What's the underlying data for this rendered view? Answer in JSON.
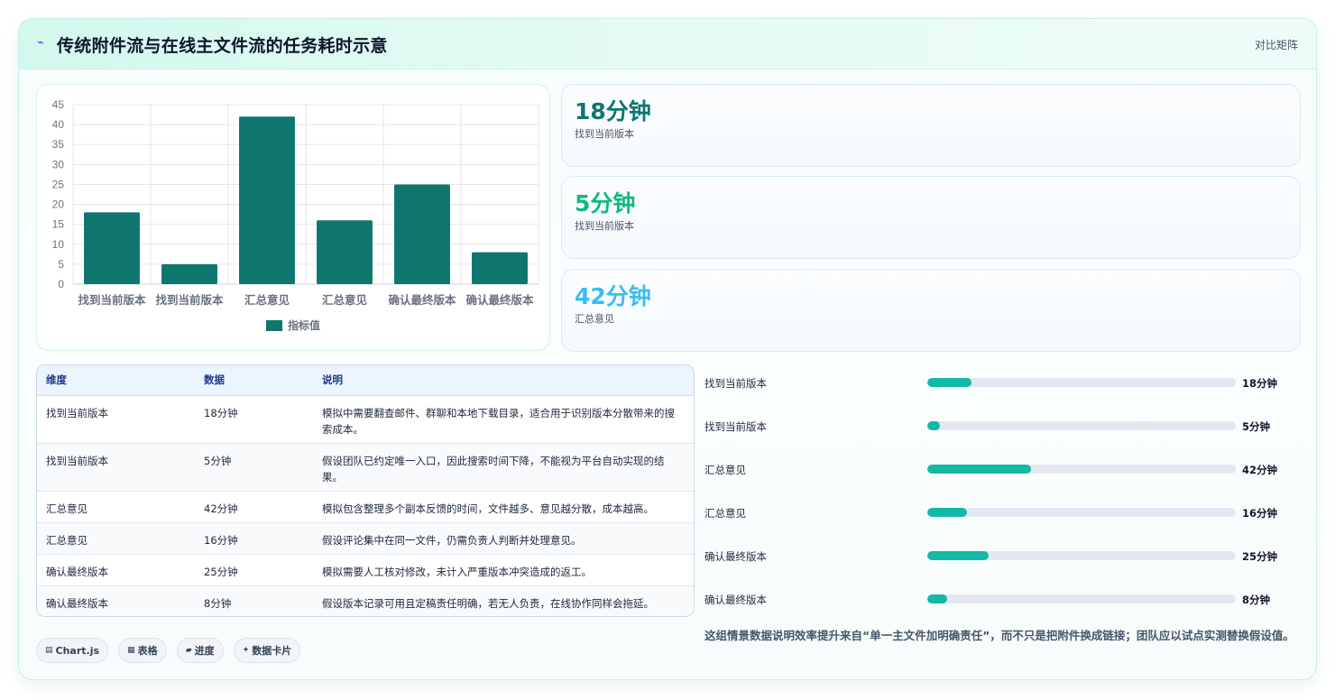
{
  "header": {
    "icon": "lightning-icon",
    "title": "传统附件流与在线主文件流的任务耗时示意",
    "right_label": "对比矩阵"
  },
  "chart_data": {
    "type": "bar",
    "categories": [
      "找到当前版本",
      "找到当前版本",
      "汇总意见",
      "汇总意见",
      "确认最终版本",
      "确认最终版本"
    ],
    "series": [
      {
        "name": "指标值",
        "values": [
          18,
          5,
          42,
          16,
          25,
          8
        ],
        "color": "#0f766e"
      }
    ],
    "title": "",
    "xlabel": "",
    "ylabel": "",
    "ylim": [
      0,
      45
    ],
    "yticks": [
      0,
      5,
      10,
      15,
      20,
      25,
      30,
      35,
      40,
      45
    ],
    "grid": true,
    "legend": "bottom"
  },
  "stats": [
    {
      "value": "18分钟",
      "label": "找到当前版本",
      "color": "#0f766e"
    },
    {
      "value": "5分钟",
      "label": "找到当前版本",
      "color": "#10b981"
    },
    {
      "value": "42分钟",
      "label": "汇总意见",
      "color": "#38bdf8"
    }
  ],
  "table": {
    "headers": [
      "维度",
      "数据",
      "说明"
    ],
    "rows": [
      [
        "找到当前版本",
        "18分钟",
        "模拟中需要翻查邮件、群聊和本地下载目录，适合用于识别版本分散带来的搜索成本。"
      ],
      [
        "找到当前版本",
        "5分钟",
        "假设团队已约定唯一入口，因此搜索时间下降，不能视为平台自动实现的结果。"
      ],
      [
        "汇总意见",
        "42分钟",
        "模拟包含整理多个副本反馈的时间，文件越多、意见越分散，成本越高。"
      ],
      [
        "汇总意见",
        "16分钟",
        "假设评论集中在同一文件，仍需负责人判断并处理意见。"
      ],
      [
        "确认最终版本",
        "25分钟",
        "模拟需要人工核对修改，未计入严重版本冲突造成的返工。"
      ],
      [
        "确认最终版本",
        "8分钟",
        "假设版本记录可用且定稿责任明确，若无人负责，在线协作同样会拖延。"
      ]
    ]
  },
  "progress": {
    "max": 125,
    "items": [
      {
        "label": "找到当前版本",
        "value": 18,
        "display": "18分钟"
      },
      {
        "label": "找到当前版本",
        "value": 5,
        "display": "5分钟"
      },
      {
        "label": "汇总意见",
        "value": 42,
        "display": "42分钟"
      },
      {
        "label": "汇总意见",
        "value": 16,
        "display": "16分钟"
      },
      {
        "label": "确认最终版本",
        "value": 25,
        "display": "25分钟"
      },
      {
        "label": "确认最终版本",
        "value": 8,
        "display": "8分钟"
      }
    ]
  },
  "note": "这组情景数据说明效率提升来自“单一主文件加明确责任”，而不只是把附件换成链接；团队应以试点实测替换假设值。",
  "tags": [
    {
      "icon": "chart-icon",
      "label": "Chart.js"
    },
    {
      "icon": "table-icon",
      "label": "表格"
    },
    {
      "icon": "progress-icon",
      "label": "进度"
    },
    {
      "icon": "sparkle-icon",
      "label": "数据卡片"
    }
  ]
}
